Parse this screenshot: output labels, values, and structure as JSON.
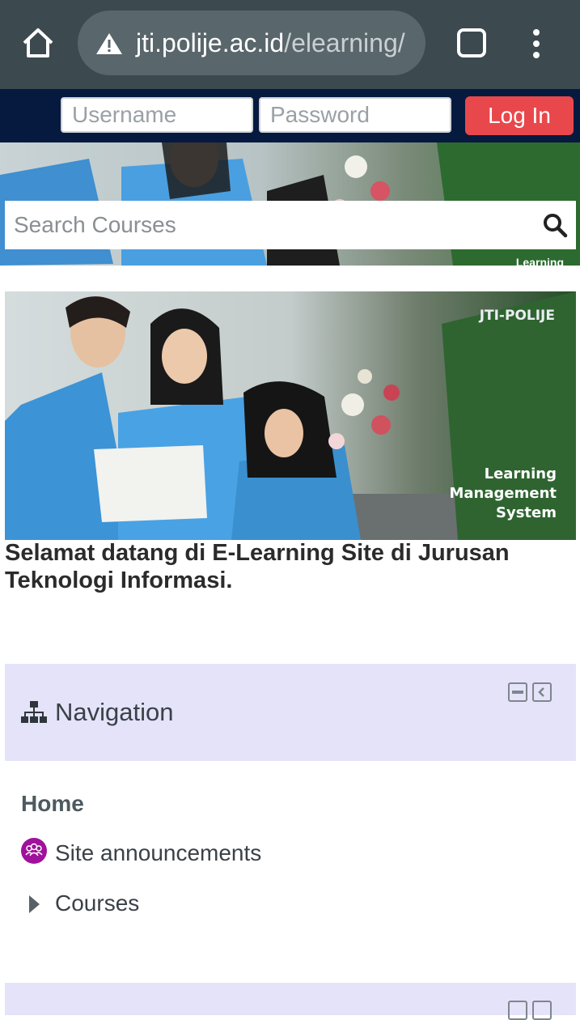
{
  "browser": {
    "url_host": "jti.polije.ac.id",
    "url_path": "/elearning/",
    "icons": [
      "home-icon",
      "warning-icon",
      "tabs-icon",
      "menu-icon"
    ]
  },
  "login": {
    "username_placeholder": "Username",
    "password_placeholder": "Password",
    "login_label": "Log In",
    "bar_color": "#06193f",
    "button_color": "#e8484b"
  },
  "search": {
    "placeholder": "Search Courses",
    "hero_text": "Learning"
  },
  "banner": {
    "brand": "JTI-POLIJE",
    "line1": "Learning",
    "line2": "Management",
    "line3": "System"
  },
  "welcome": "Selamat datang di E-Learning Site di Jurusan Teknologi Informasi.",
  "navigation": {
    "title": "Navigation",
    "home": "Home",
    "items": [
      {
        "label": "Site announcements",
        "icon": "users-icon"
      },
      {
        "label": "Courses",
        "icon": "caret-right-icon"
      }
    ],
    "header_bg": "#e5e3fa",
    "announcement_icon_color": "#a0119c"
  }
}
